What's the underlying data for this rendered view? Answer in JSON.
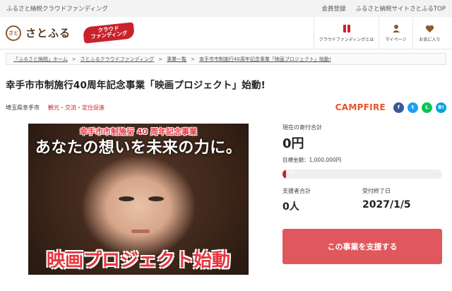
{
  "topbar": {
    "site_label": "ふるさと納税クラウドファンディング",
    "links": [
      "会員登録",
      "ふるさと納税サイトさとふるTOP"
    ]
  },
  "header": {
    "logo_mark": "さと",
    "logo_text": "さとふる",
    "badge_line1": "クラウド",
    "badge_line2": "ファンディング",
    "nav": [
      {
        "label": "クラウドファンディングとは",
        "icon": "book-icon"
      },
      {
        "label": "マイページ",
        "icon": "user-icon"
      },
      {
        "label": "お気に入り",
        "icon": "heart-icon"
      }
    ]
  },
  "breadcrumb": [
    "「ふるさと納税」ホーム",
    "さとふるクラウドファンディング",
    "事業一覧",
    "幸手市市制施行40周年記念事業「映画プロジェクト」始動!"
  ],
  "project": {
    "title": "幸手市市制施行40周年記念事業「映画プロジェクト」始動!",
    "region": "埼玉県幸手市",
    "category": "観光・交流・定住促進",
    "platform": "CAMPFIRE",
    "image": {
      "top_text": "幸手市市制施行 40 周年記念事業",
      "main_text": "あなたの想いを未来の力に。",
      "bottom_text": "映画プロジェクト始動"
    }
  },
  "share": [
    {
      "name": "facebook-icon",
      "glyph": "f",
      "color": "#3b5998"
    },
    {
      "name": "twitter-icon",
      "glyph": "t",
      "color": "#1da1f2"
    },
    {
      "name": "line-icon",
      "glyph": "L",
      "color": "#06c755"
    },
    {
      "name": "hatena-icon",
      "glyph": "B!",
      "color": "#00a4de"
    }
  ],
  "funding": {
    "current_label": "現在の寄付合計",
    "current_amount": "0円",
    "goal": "目標金額：1,000,000円",
    "progress_fraction": 0.0,
    "progress_text": "0%",
    "supporters_label": "支援者合計",
    "supporters_value": "0人",
    "end_label": "受付終了日",
    "end_value": "2027/1/5",
    "support_button": "この事業を支援する"
  },
  "colors": {
    "accent": "#c8232c",
    "button": "#e0575d",
    "campfire": "#e8532b"
  }
}
